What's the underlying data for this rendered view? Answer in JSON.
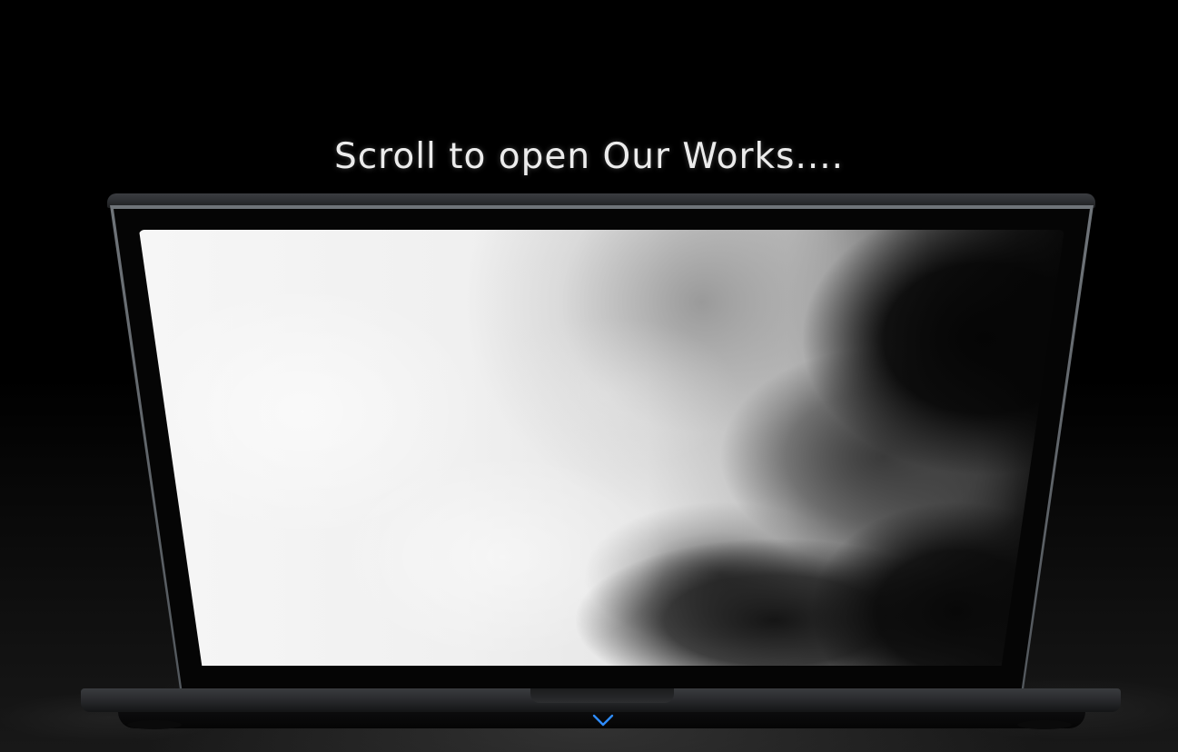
{
  "page": {
    "headline": "Scroll to open Our Works....",
    "accent_color": "#2e8cff"
  },
  "laptop": {
    "screen_content": "smoke-clouds-image"
  },
  "scroll_cue": {
    "icon": "chevron-down-icon"
  }
}
